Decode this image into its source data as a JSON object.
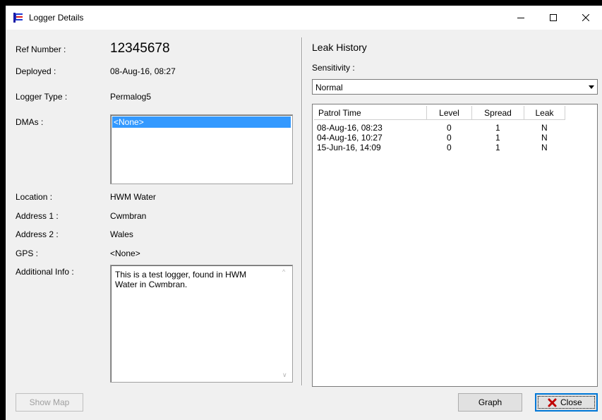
{
  "window": {
    "title": "Logger Details"
  },
  "details": {
    "ref_label": "Ref Number :",
    "ref_value": "12345678",
    "deployed_label": "Deployed :",
    "deployed_value": "08-Aug-16, 08:27",
    "type_label": "Logger Type :",
    "type_value": "Permalog5",
    "dmas_label": "DMAs :",
    "dmas_items": [
      "<None>"
    ],
    "location_label": "Location :",
    "location_value": "HWM Water",
    "address1_label": "Address 1 :",
    "address1_value": "Cwmbran",
    "address2_label": "Address 2 :",
    "address2_value": "Wales",
    "gps_label": "GPS :",
    "gps_value": "<None>",
    "info_label": "Additional Info :",
    "info_value": "This is a test logger, found in HWM Water in Cwmbran."
  },
  "leak_history": {
    "heading": "Leak History",
    "sensitivity_label": "Sensitivity :",
    "sensitivity_value": "Normal",
    "columns": [
      "Patrol Time",
      "Level",
      "Spread",
      "Leak"
    ],
    "rows": [
      [
        "08-Aug-16, 08:23",
        "0",
        "1",
        "N"
      ],
      [
        "04-Aug-16, 10:27",
        "0",
        "1",
        "N"
      ],
      [
        "15-Jun-16, 14:09",
        "0",
        "1",
        "N"
      ]
    ]
  },
  "buttons": {
    "show_map": "Show Map",
    "graph": "Graph",
    "close": "Close"
  },
  "icons": {
    "app": "app-flag-icon",
    "minimize": "minimize-icon",
    "maximize": "maximize-icon",
    "close_window": "close-icon",
    "dropdown": "chevron-down-icon",
    "close_button": "red-x-icon"
  },
  "colors": {
    "selection": "#3399ff",
    "default_button_border": "#0078d7",
    "close_x": "#c00000"
  }
}
